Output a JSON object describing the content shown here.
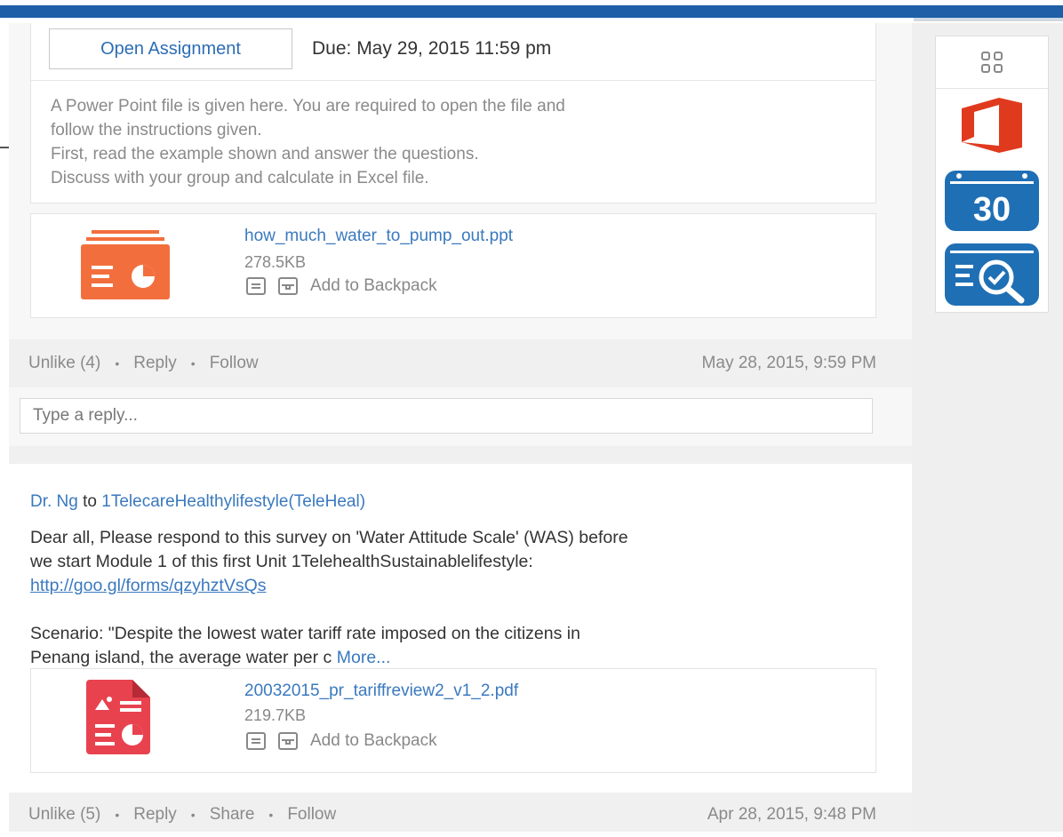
{
  "assignment": {
    "open_button": "Open Assignment",
    "due": "Due: May 29, 2015 11:59 pm",
    "description": [
      "A Power Point file is given here. You are required to open the file and",
      "follow the instructions given.",
      "First, read the example shown and answer the questions.",
      "Discuss with your group and calculate in Excel file."
    ]
  },
  "attachment1": {
    "filename": "how_much_water_to_pump_out.ppt",
    "size": "278.5KB",
    "action": "Add to Backpack",
    "icon": "ppt-file-icon",
    "color": "#f26f3d"
  },
  "post1_actions": {
    "unlike": "Unlike (4)",
    "reply": "Reply",
    "follow": "Follow",
    "separator": "•",
    "timestamp": "May 28, 2015, 9:59 PM"
  },
  "reply_box": {
    "placeholder": "Type a reply..."
  },
  "post2": {
    "author": "Dr. Ng",
    "to": "to",
    "group": "1TelecareHealthylifestyle(TeleHeal)",
    "body_line1": "Dear all, Please respond to this survey on 'Water Attitude Scale' (WAS) before",
    "body_line2": "we start Module 1 of this first Unit 1TelehealthSustainablelifestyle:",
    "url": "http://goo.gl/forms/qzyhztVsQs",
    "scenario_line1": "Scenario: \"Despite the lowest water tariff rate imposed on the citizens in",
    "scenario_line2": "Penang island, the average water per c",
    "more": "More..."
  },
  "attachment2": {
    "filename": "20032015_pr_tariffreview2_v1_2.pdf",
    "size": "219.7KB",
    "action": "Add to Backpack",
    "icon": "pdf-file-icon",
    "color": "#e8424f"
  },
  "post2_actions": {
    "unlike": "Unlike (5)",
    "reply": "Reply",
    "share": "Share",
    "follow": "Follow",
    "separator": "•",
    "timestamp": "Apr 28, 2015, 9:48 PM"
  },
  "apps_panel": {
    "calendar_day": "30",
    "icons": [
      "app-grid-icon",
      "office-icon",
      "calendar-icon",
      "search-review-icon"
    ],
    "office_color": "#e03a1e",
    "calendar_color": "#1f6fb5"
  }
}
